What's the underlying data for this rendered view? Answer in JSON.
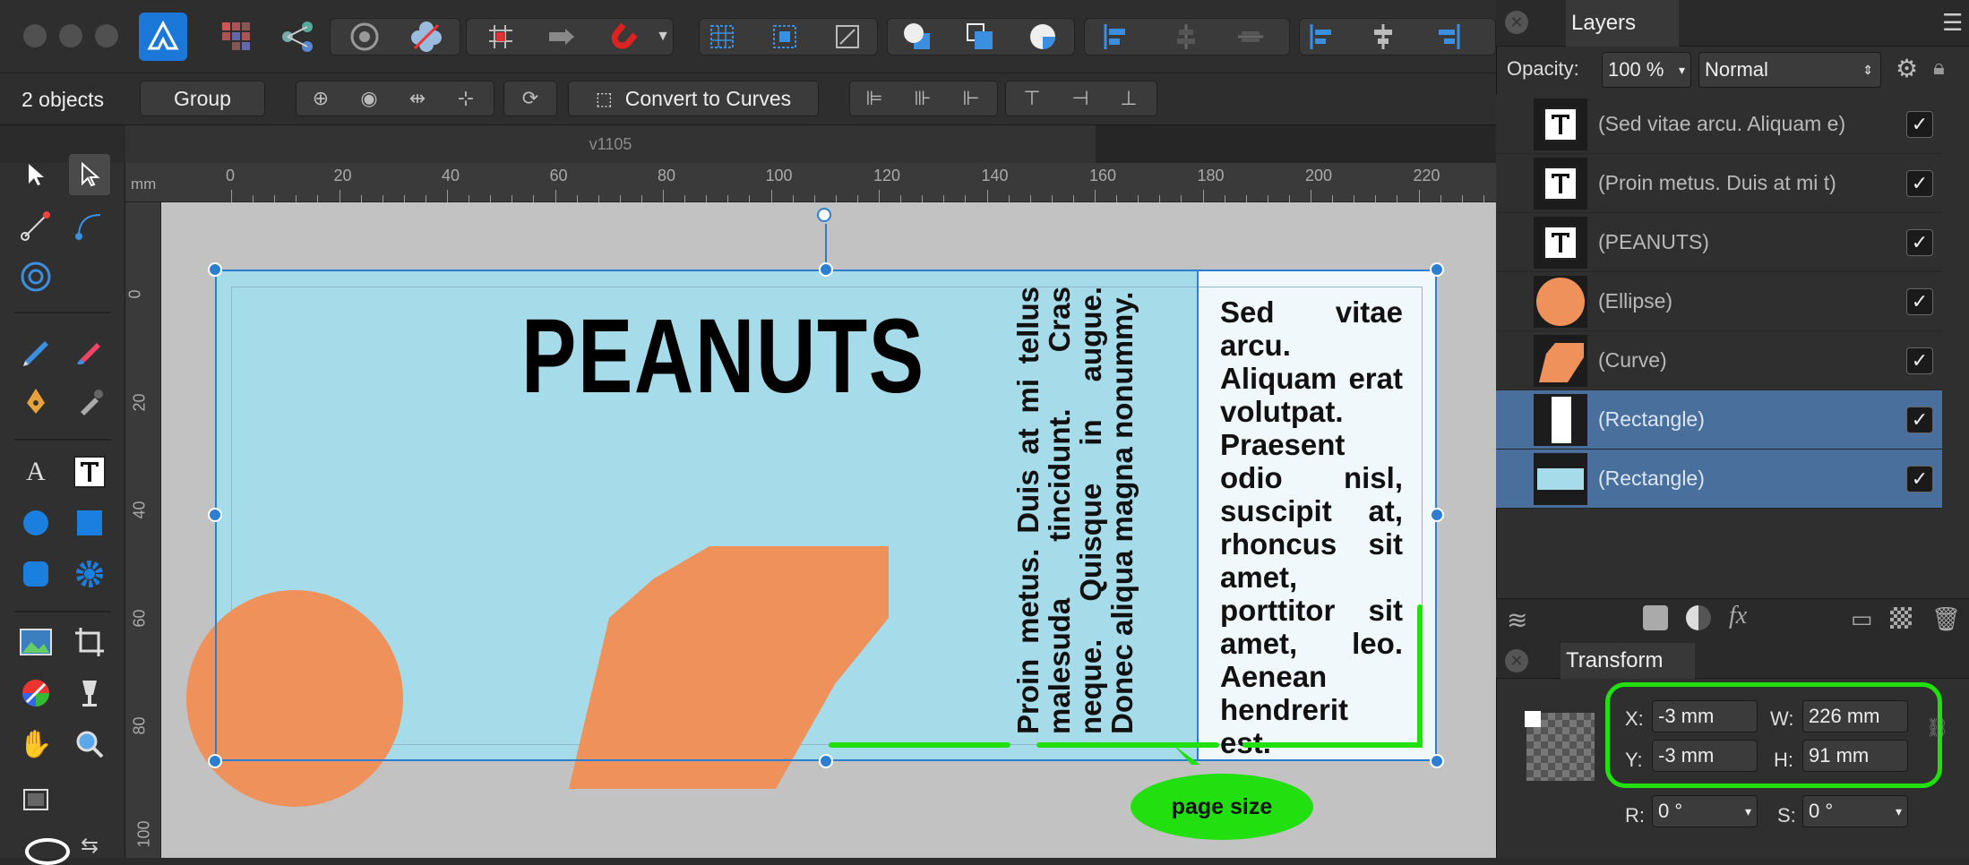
{
  "toolbar": {
    "personas": [
      "Designer Persona",
      "Pixel Persona",
      "Export Persona"
    ],
    "icons": [
      "affinity-logo-icon",
      "persona-designer-icon",
      "share-icon",
      "assistant-icon",
      "flower-icon",
      "grid-icon",
      "arrow-icon",
      "magnet-icon",
      "dropdown-icon",
      "snap-grid-icon",
      "snap-frame-icon",
      "snap-transform-icon",
      "boolean-add-icon",
      "boolean-subtract-icon",
      "boolean-intersect-icon",
      "align-left-icon",
      "align-center-icon",
      "align-right-icon"
    ]
  },
  "context": {
    "selection_label": "2 objects",
    "group_label": "Group",
    "convert_label": "Convert to Curves"
  },
  "document": {
    "tab_title": "v1105",
    "ruler_unit": "mm",
    "ruler_top_labels": [
      "0",
      "20",
      "40",
      "60",
      "80",
      "100",
      "120",
      "140",
      "160",
      "180",
      "200",
      "220"
    ],
    "ruler_left_labels": [
      "0",
      "20",
      "40",
      "60",
      "80",
      "100"
    ]
  },
  "artwork": {
    "title": "PEANUTS",
    "vertical_text": "Proin metus. Duis at mi tellus malesuda tincidunt. Cras neque. Quisque in augue. Donec aliqua magna nonummy.",
    "side_text": "Sed vitae arcu. Aliquam erat volutpat. Praesent odio nisl, suscipit at, rhoncus sit amet, porttitor sit amet, leo. Aenean hendrerit est.",
    "annotation": "page size",
    "colors": {
      "background": "#a6dbea",
      "shape": "#ef915b",
      "side_panel": "#f1f8fb",
      "annotation": "#22e00f",
      "selection": "#2c7fd0"
    }
  },
  "layers_panel": {
    "title": "Layers",
    "opacity_label": "Opacity:",
    "opacity_value": "100 %",
    "blend_mode": "Normal",
    "layers": [
      {
        "name": "(Sed vitae arcu. Aliquam e)",
        "type": "text",
        "selected": false,
        "visible": true
      },
      {
        "name": "(Proin metus. Duis at mi t)",
        "type": "text",
        "selected": false,
        "visible": true
      },
      {
        "name": "(PEANUTS)",
        "type": "text",
        "selected": false,
        "visible": true
      },
      {
        "name": "(Ellipse)",
        "type": "ellipse",
        "selected": false,
        "visible": true
      },
      {
        "name": "(Curve)",
        "type": "curve",
        "selected": false,
        "visible": true
      },
      {
        "name": "(Rectangle)",
        "type": "rectangle-white",
        "selected": true,
        "visible": true
      },
      {
        "name": "(Rectangle)",
        "type": "rectangle-blue",
        "selected": true,
        "visible": true
      }
    ]
  },
  "transform_panel": {
    "title": "Transform",
    "x_label": "X:",
    "x_value": "-3 mm",
    "y_label": "Y:",
    "y_value": "-3 mm",
    "w_label": "W:",
    "w_value": "226 mm",
    "h_label": "H:",
    "h_value": "91 mm",
    "r_label": "R:",
    "r_value": "0 °",
    "s_label": "S:",
    "s_value": "0 °"
  }
}
